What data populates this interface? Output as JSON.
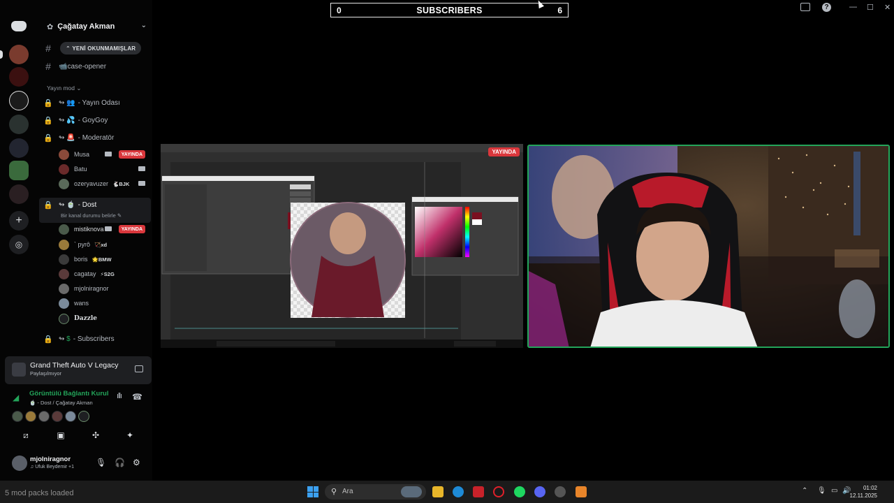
{
  "server": {
    "name": "Çağatay Akman"
  },
  "channels_top": [
    {
      "kind": "text",
      "label": "YENİ OKUNMAMIŞLAR"
    },
    {
      "kind": "text",
      "label": "📹case-opener"
    }
  ],
  "category": {
    "label": "Yayın mod"
  },
  "voice_channels": [
    {
      "label": "- Yayın Odası"
    },
    {
      "label": "- GoyGoy"
    },
    {
      "label": "- Moderatör"
    },
    {
      "label": "- Dost"
    },
    {
      "label": "- Subscribers"
    }
  ],
  "moderator_users": [
    {
      "name": "Musa",
      "live": "YAYINDA"
    },
    {
      "name": "Batu"
    },
    {
      "name": "ozeryavuzer",
      "tag": "🐇BJK"
    }
  ],
  "dost_status": "Bir kanal durumu belirle",
  "dost_users": [
    {
      "name": "mistiknova",
      "live": "YAYINDA"
    },
    {
      "name": "` pyrô",
      "tag": "🏹xd"
    },
    {
      "name": "boris",
      "tag": "🌟BMW"
    },
    {
      "name": "cagatay",
      "tag": "⚡S2G"
    },
    {
      "name": "mjolniragnor"
    },
    {
      "name": "wans"
    },
    {
      "name": "Dazzle"
    }
  ],
  "activity": {
    "title": "Grand Theft Auto V Legacy",
    "sub": "Paylaşılmıyor"
  },
  "voice_status": {
    "title": "Görüntülü Bağlantı Kurul",
    "channel": "🍵 - Dost / Çağatay Akman"
  },
  "user": {
    "name": "mjolniragnor",
    "status": "♫ Ufuk Beydemir +1"
  },
  "subscribers": {
    "left": "0",
    "label": "SUBSCRIBERS",
    "right": "6"
  },
  "stream": {
    "live_label": "YAYINDA"
  },
  "taskbar": {
    "status": "5 mod packs loaded",
    "search": "Ara",
    "time": "01:02",
    "date": "12.11.2025"
  },
  "colors": {
    "live": "#da373c",
    "online": "#23a55a",
    "bg": "#050505"
  }
}
